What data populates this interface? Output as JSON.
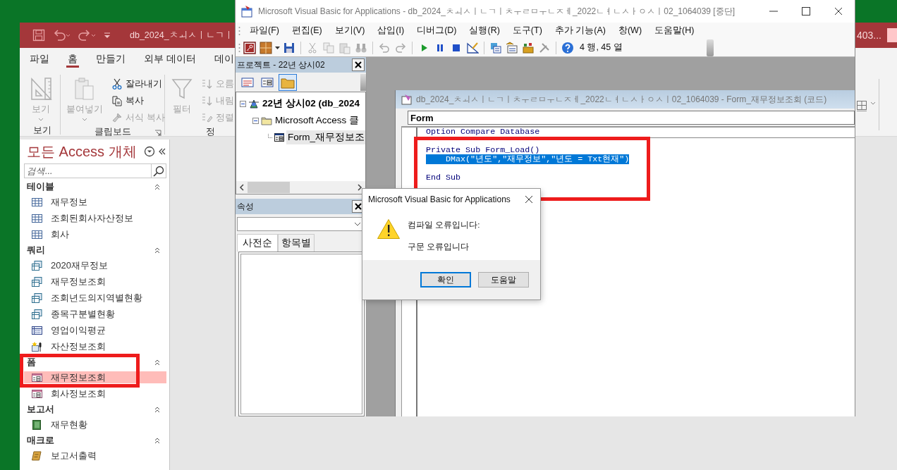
{
  "access": {
    "title": "db_2024_ㅊㅚㅅㅣㄴㄱㅣ",
    "title_tail": "403...",
    "tabs": [
      {
        "label": "파일",
        "selected": false
      },
      {
        "label": "홈",
        "selected": true
      },
      {
        "label": "만들기",
        "selected": false
      },
      {
        "label": "외부 데이터",
        "selected": false
      },
      {
        "label": "데이",
        "selected": false
      }
    ],
    "ribbon_groups": [
      {
        "label": "보기",
        "buttons": [
          {
            "kind": "large",
            "label": "보기",
            "disabled": true,
            "dropdown": true
          }
        ]
      },
      {
        "label": "클립보드",
        "launcher": true,
        "buttons": [
          {
            "kind": "large",
            "label": "붙여넣기",
            "disabled": true,
            "dropdown": true
          },
          {
            "kind": "small",
            "label": "잘라내기",
            "disabled": false
          },
          {
            "kind": "small",
            "label": "복사",
            "disabled": false
          },
          {
            "kind": "small",
            "label": "서식 복사",
            "disabled": true
          }
        ]
      },
      {
        "label": "정",
        "buttons": [
          {
            "kind": "large",
            "label": "필터",
            "disabled": true
          },
          {
            "kind": "small",
            "label": "오름",
            "disabled": true
          },
          {
            "kind": "small",
            "label": "내림",
            "disabled": true
          },
          {
            "kind": "small",
            "label": "정렬",
            "disabled": true
          }
        ]
      }
    ],
    "nav": {
      "title": "모든 Access 개체",
      "search_placeholder": "검색...",
      "groups": [
        {
          "label": "테이블",
          "expanded": true,
          "items": [
            {
              "label": "재무정보",
              "kind": "table",
              "selected": false
            },
            {
              "label": "조회된회사자산정보",
              "kind": "table",
              "selected": false
            },
            {
              "label": "회사",
              "kind": "table",
              "selected": false
            }
          ]
        },
        {
          "label": "쿼리",
          "expanded": true,
          "items": [
            {
              "label": "2020재무정보",
              "kind": "query",
              "selected": false
            },
            {
              "label": "재무정보조회",
              "kind": "query",
              "selected": false
            },
            {
              "label": "조회년도의지역별현황",
              "kind": "query",
              "selected": false
            },
            {
              "label": "종목구분별현황",
              "kind": "query",
              "selected": false
            },
            {
              "label": "영업이익평균",
              "kind": "crosstab",
              "selected": false
            },
            {
              "label": "자산정보조회",
              "kind": "action",
              "selected": false
            }
          ]
        },
        {
          "label": "폼",
          "expanded": true,
          "annotated": true,
          "items": [
            {
              "label": "재무정보조회",
              "kind": "form",
              "selected": true
            },
            {
              "label": "회사정보조회",
              "kind": "form",
              "selected": false
            }
          ]
        },
        {
          "label": "보고서",
          "expanded": true,
          "items": [
            {
              "label": "재무현황",
              "kind": "report",
              "selected": false
            }
          ]
        },
        {
          "label": "매크로",
          "expanded": true,
          "items": [
            {
              "label": "보고서출력",
              "kind": "macro",
              "selected": false
            }
          ]
        }
      ]
    }
  },
  "vba": {
    "title": "Microsoft Visual Basic for Applications - db_2024_ㅊㅚㅅㅣㄴㄱㅣㅊㅜㄹㅁㅜㄴㅈㅔ_2022ㄴㅕㄴㅅㅏㅇㅅㅣ02_1064039 [중단]",
    "menu": [
      "파일(F)",
      "편집(E)",
      "보기(V)",
      "삽입(I)",
      "디버그(D)",
      "실행(R)",
      "도구(T)",
      "추가 기능(A)",
      "창(W)",
      "도움말(H)"
    ],
    "cursor_position": "4 행, 45 열",
    "project": {
      "title": "프로젝트 - 22년 상시02",
      "tree": [
        {
          "label": "22년 상시02 (db_2024",
          "selected": false,
          "expanded": true,
          "children": [
            {
              "label": "Microsoft Access 클",
              "selected": false,
              "expanded": true,
              "children": [
                {
                  "label": "Form_재무정보조",
                  "selected": true
                }
              ]
            }
          ]
        }
      ]
    },
    "properties": {
      "title": "속성",
      "tabs": [
        {
          "label": "사전순",
          "selected": true
        },
        {
          "label": "항목별",
          "selected": false
        }
      ]
    },
    "code_window": {
      "annotated": true,
      "title": "db_2024_ㅊㅚㅅㅣㄴㄱㅣㅊㅜㄹㅁㅜㄴㅈㅔ_2022ㄴㅕㄴㅅㅏㅇㅅㅣ02_1064039 - Form_재무정보조회 (코드)",
      "object": "Form",
      "lines": [
        {
          "text": "Option Compare Database",
          "separator_after": true,
          "selected": false
        },
        {
          "text": "Private Sub Form_Load()",
          "selected": false
        },
        {
          "text": "    DMax(\"년도\",\"재무정보\",\"년도 = Txt현재\")",
          "selected": true
        },
        {
          "text": "End Sub",
          "blank_before": true,
          "selected": false
        }
      ]
    }
  },
  "dialog": {
    "title": "Microsoft Visual Basic for Applications",
    "messages": [
      "컴파일 오류입니다:",
      "구문 오류입니다"
    ],
    "buttons": [
      {
        "label": "확인",
        "default": true
      },
      {
        "label": "도움말",
        "default": false
      }
    ]
  }
}
